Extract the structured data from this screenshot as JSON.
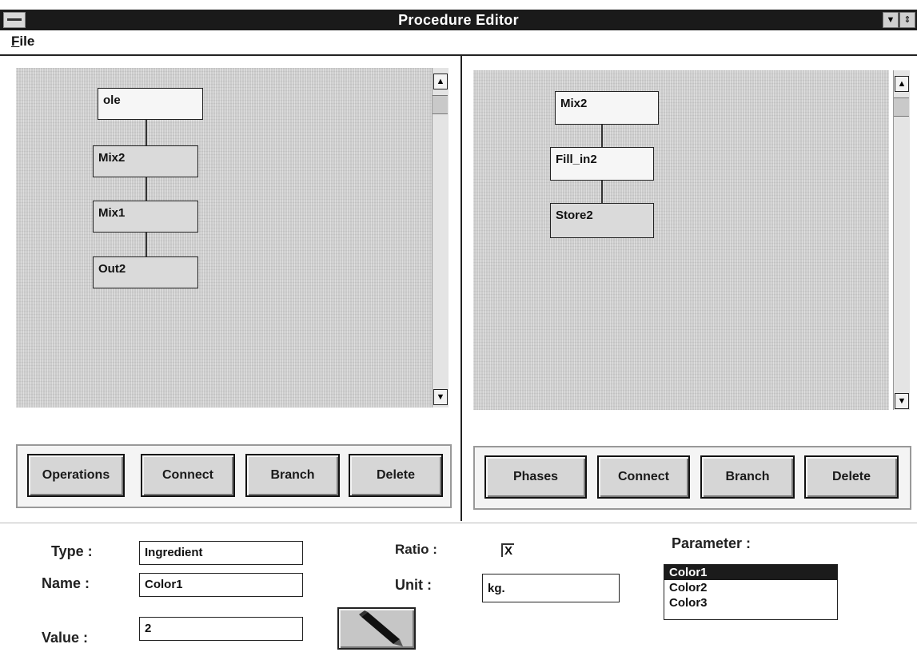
{
  "window": {
    "title": "Procedure Editor"
  },
  "menu": {
    "file_prefix": "F",
    "file_rest": "ile"
  },
  "left_pane": {
    "nodes": [
      "ole",
      "Mix2",
      "Mix1",
      "Out2"
    ],
    "buttons": {
      "operations": "Operations",
      "connect": "Connect",
      "branch": "Branch",
      "delete": "Delete"
    }
  },
  "right_pane": {
    "nodes": [
      "Mix2",
      "Fill_in2",
      "Store2"
    ],
    "buttons": {
      "phases": "Phases",
      "connect": "Connect",
      "branch": "Branch",
      "delete": "Delete"
    }
  },
  "properties": {
    "type_label": "Type :",
    "type_value": "Ingredient",
    "name_label": "Name :",
    "name_value": "Color1",
    "value_label": "Value :",
    "value_value": "2",
    "ratio_label": "Ratio :",
    "ratio_checked": "X",
    "unit_label": "Unit :",
    "unit_value": "kg.",
    "parameter_label": "Parameter :",
    "parameters": [
      "Color1",
      "Color2",
      "Color3"
    ],
    "selected_parameter": "Color1"
  },
  "icons": {
    "edit_button": "pencil-icon",
    "scroll_up": "arrow-up-icon",
    "scroll_down": "arrow-down-icon"
  }
}
